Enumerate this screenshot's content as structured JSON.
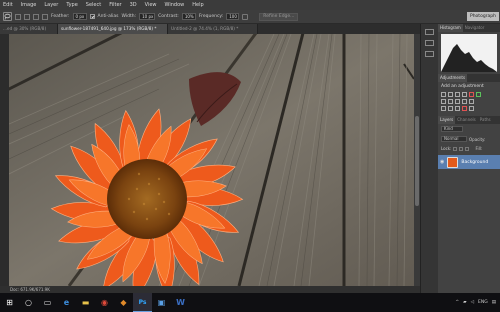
{
  "menubar": {
    "items": [
      "Edit",
      "Image",
      "Layer",
      "Type",
      "Select",
      "Filter",
      "3D",
      "View",
      "Window",
      "Help"
    ]
  },
  "options": {
    "feather_label": "Feather:",
    "feather_value": "0 px",
    "antialias_label": "Anti-alias",
    "width_label": "Width:",
    "width_value": "10 px",
    "contrast_label": "Contrast:",
    "contrast_value": "10%",
    "frequency_label": "Frequency:",
    "frequency_value": "100",
    "refine_edge_label": "Refine Edge...",
    "workspace_label": "Photograph"
  },
  "tabs": [
    {
      "label": "...ed @ 30% (RGB/8)",
      "active": false
    },
    {
      "label": "sunflower-187491_640.jpg @ 173% (RGB/8) *",
      "active": true
    },
    {
      "label": "Untitled-2 @ 74.4% (1, RGB/8) *",
      "active": false
    }
  ],
  "status": {
    "zoom": "",
    "doc": "Doc: 671.9K/671.9K"
  },
  "panels": {
    "top_tabs": [
      "Histogram",
      "Navigator"
    ],
    "adjustments_tab": "Adjustments",
    "adjustments_title": "Add an adjustment",
    "layers_tabs": [
      "Layers",
      "Channels",
      "Paths"
    ],
    "kind_label": "Kind",
    "blend_mode": "Normal",
    "opacity_label": "Opacity:",
    "lock_label": "Lock:",
    "fill_label": "Fill:",
    "layer_name": "Background"
  },
  "taskbar": {
    "tray_lang": "ENG",
    "tray_time": "",
    "apps": [
      {
        "icon": "windows-start-icon",
        "glyph": "⊞"
      },
      {
        "icon": "search-icon",
        "glyph": "○"
      },
      {
        "icon": "task-view-icon",
        "glyph": "▭"
      },
      {
        "icon": "edge-browser-icon",
        "glyph": "e"
      },
      {
        "icon": "file-explorer-icon",
        "glyph": "▬"
      },
      {
        "icon": "chrome-icon",
        "glyph": "◉"
      },
      {
        "icon": "media-player-icon",
        "glyph": "◆"
      },
      {
        "icon": "photoshop-icon",
        "glyph": "Ps"
      },
      {
        "icon": "store-icon",
        "glyph": "▣"
      },
      {
        "icon": "word-icon",
        "glyph": "W"
      }
    ]
  },
  "colors": {
    "ui_dark": "#3b3b3b",
    "accent_selected_layer": "#5a7fb0",
    "petal_orange": "#ee5a1c",
    "sunflower_center": "#8a4a14"
  }
}
